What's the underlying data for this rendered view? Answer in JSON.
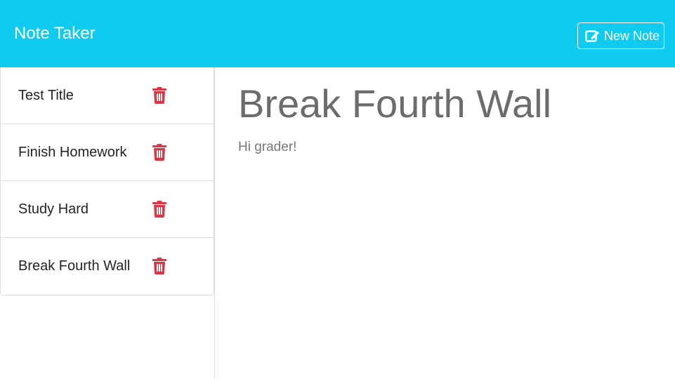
{
  "app": {
    "title": "Note Taker"
  },
  "toolbar": {
    "new_note_label": "New Note",
    "new_note_icon": "edit-icon"
  },
  "colors": {
    "navbar": "#0fcbef",
    "trash": "#dc3545"
  },
  "notes": [
    {
      "title": "Test Title",
      "delete_icon": "trash-icon"
    },
    {
      "title": "Finish Homework",
      "delete_icon": "trash-icon"
    },
    {
      "title": "Study Hard",
      "delete_icon": "trash-icon"
    },
    {
      "title": "Break Fourth Wall",
      "delete_icon": "trash-icon"
    }
  ],
  "active_note": {
    "title": "Break Fourth Wall",
    "text": "Hi grader!"
  }
}
